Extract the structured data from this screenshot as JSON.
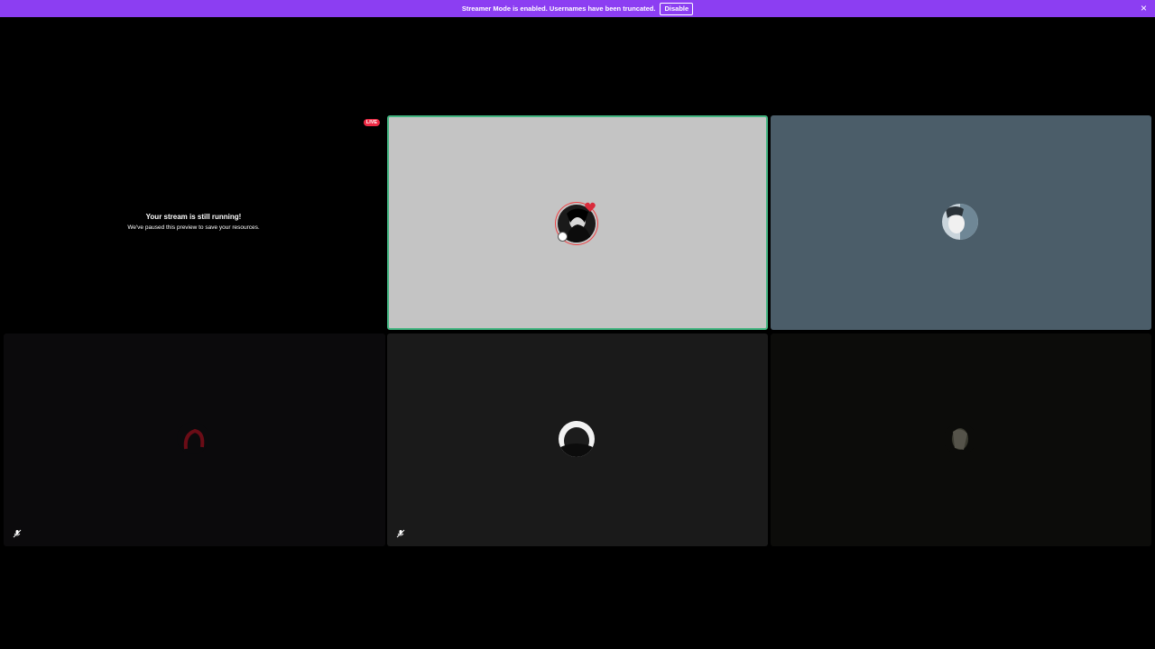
{
  "banner": {
    "message": "Streamer Mode is enabled. Usernames have been truncated.",
    "disable_label": "Disable",
    "close_glyph": "×",
    "background": "#8c3ef2"
  },
  "stream_tile": {
    "live_label": "LIVE",
    "paused_title": "Your stream is still running!",
    "paused_subtitle": "We've paused this preview to save your resources."
  },
  "tiles": [
    {
      "id": "stream-preview",
      "background": "#000000"
    },
    {
      "id": "participant-1",
      "background": "#c4c4c4",
      "speaking": true,
      "speaking_color": "#43b581"
    },
    {
      "id": "participant-2",
      "background": "#4b5d69"
    },
    {
      "id": "participant-3",
      "background": "#0b0a0c",
      "muted": true
    },
    {
      "id": "participant-4",
      "background": "#1a1a1a",
      "muted": true
    },
    {
      "id": "participant-5",
      "background": "#0c0c0a"
    }
  ],
  "icons": {
    "mute": "microphone-muted-icon",
    "close": "close-icon"
  }
}
